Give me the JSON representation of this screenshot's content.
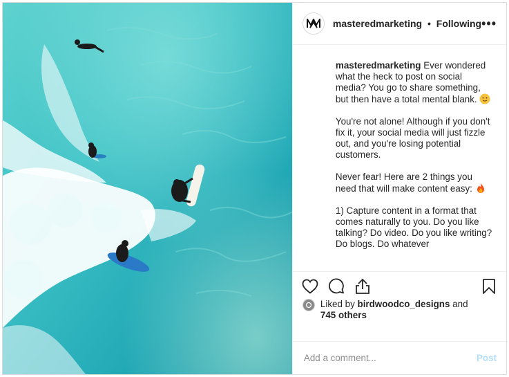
{
  "header": {
    "username": "masteredmarketing",
    "separator": "•",
    "follow_status": "Following",
    "more_label": "•••"
  },
  "caption": {
    "username": "masteredmarketing",
    "para1": "Ever wondered what the heck to post on social media? You go to share something, but then have a total mental blank.",
    "para2": "You're not alone! Although if you don't fix it, your social media will just fizzle out, and you're losing potential customers.",
    "para3": "Never fear! Here are 2 things you need that will make content easy:",
    "para4": "1) Capture content in a format that comes naturally to you. Do you like talking? Do video. Do you like writing? Do blogs. Do whatever"
  },
  "icons": {
    "like": "heart-icon",
    "comment": "comment-icon",
    "share": "share-icon",
    "save": "bookmark-icon",
    "emoji1": "slightly-smiling-emoji",
    "emoji2": "fire-emoji"
  },
  "likes": {
    "prefix": "Liked by",
    "user": "birdwoodco_designs",
    "and": "and",
    "others": "745 others"
  },
  "comment": {
    "placeholder": "Add a comment...",
    "post_label": "Post"
  },
  "colors": {
    "link_disabled": "#b2dffc",
    "text": "#262626",
    "muted": "#8e8e8e",
    "ocean": "#2bb4bd"
  }
}
